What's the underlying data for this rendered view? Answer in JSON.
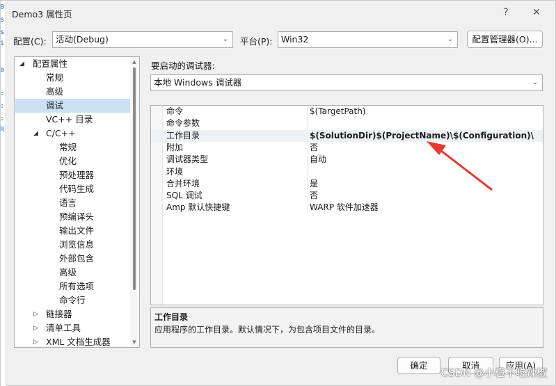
{
  "window": {
    "title": "Demo3 属性页",
    "help_glyph": "?",
    "close_glyph": "✕"
  },
  "left_strip_text": [
    "0",
    "s",
    "s",
    "i",
    "a",
    ":",
    ":",
    ":",
    "R"
  ],
  "toolbar": {
    "config_label": "配置(C):",
    "config_value": "活动(Debug)",
    "platform_label": "平台(P):",
    "platform_value": "Win32",
    "config_manager_label": "配置管理器(O)..."
  },
  "tree": {
    "items": [
      {
        "label": "配置属性",
        "expand": "◢"
      },
      {
        "label": "常规",
        "expand": ""
      },
      {
        "label": "高级",
        "expand": ""
      },
      {
        "label": "调试",
        "expand": ""
      },
      {
        "label": "VC++ 目录",
        "expand": ""
      },
      {
        "label": "C/C++",
        "expand": "◢"
      },
      {
        "label": "常规",
        "expand": ""
      },
      {
        "label": "优化",
        "expand": ""
      },
      {
        "label": "预处理器",
        "expand": ""
      },
      {
        "label": "代码生成",
        "expand": ""
      },
      {
        "label": "语言",
        "expand": ""
      },
      {
        "label": "预编译头",
        "expand": ""
      },
      {
        "label": "输出文件",
        "expand": ""
      },
      {
        "label": "浏览信息",
        "expand": ""
      },
      {
        "label": "外部包含",
        "expand": ""
      },
      {
        "label": "高级",
        "expand": ""
      },
      {
        "label": "所有选项",
        "expand": ""
      },
      {
        "label": "命令行",
        "expand": ""
      },
      {
        "label": "链接器",
        "expand": "▷"
      },
      {
        "label": "清单工具",
        "expand": "▷"
      },
      {
        "label": "XML 文档生成器",
        "expand": "▷"
      }
    ],
    "selected_index": 3
  },
  "debugger": {
    "label": "要启动的调试器:",
    "value": "本地 Windows 调试器"
  },
  "properties": [
    {
      "name": "命令",
      "value": "$(TargetPath)"
    },
    {
      "name": "命令参数",
      "value": ""
    },
    {
      "name": "工作目录",
      "value": "$(SolutionDir)$(ProjectName)\\$(Configuration)\\"
    },
    {
      "name": "附加",
      "value": "否"
    },
    {
      "name": "调试器类型",
      "value": "自动"
    },
    {
      "name": "环境",
      "value": ""
    },
    {
      "name": "合并环境",
      "value": "是"
    },
    {
      "name": "SQL 调试",
      "value": "否"
    },
    {
      "name": "Amp 默认快捷键",
      "value": "WARP 软件加速器"
    }
  ],
  "highlighted_property_index": 2,
  "description": {
    "title": "工作目录",
    "text": "应用程序的工作目录。默认情况下，为包含项目文件的目录。"
  },
  "buttons": {
    "ok": "确定",
    "cancel": "取消",
    "apply": "应用(A)"
  },
  "watermark": "CSDN @小橙不吃辣椒",
  "colors": {
    "accent_selection": "#cce0f4",
    "annotation_arrow": "#e8382f"
  }
}
